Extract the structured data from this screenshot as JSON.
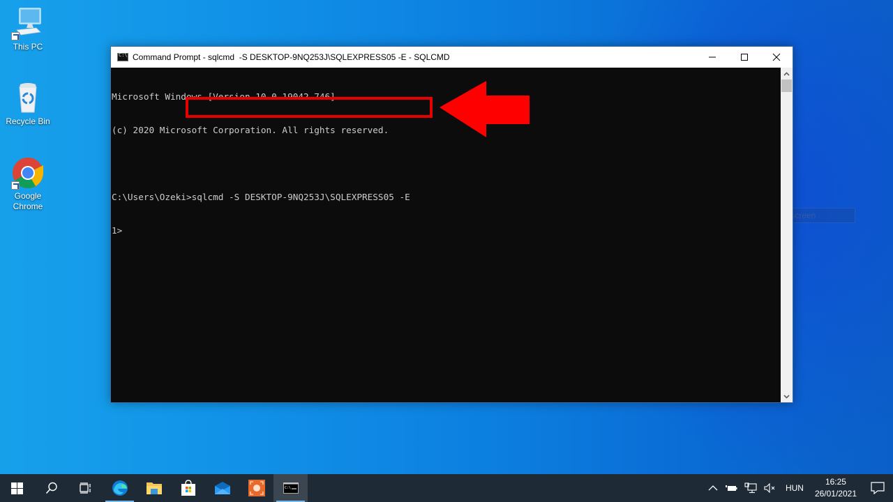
{
  "desktop": {
    "icons": [
      {
        "label": "This PC",
        "icon": "computer-icon",
        "shortcut": true
      },
      {
        "label": "Recycle Bin",
        "icon": "recycle-bin-icon",
        "shortcut": false
      },
      {
        "label": "Google\nChrome",
        "label_line1": "Google",
        "label_line2": "Chrome",
        "icon": "chrome-icon",
        "shortcut": true
      }
    ]
  },
  "window": {
    "title": "Command Prompt - sqlcmd  -S DESKTOP-9NQ253J\\SQLEXPRESS05 -E - SQLCMD",
    "icon": "command-prompt-icon",
    "controls": [
      "minimize",
      "maximize",
      "close"
    ],
    "console_lines": [
      "Microsoft Windows [Version 10.0.19042.746]",
      "(c) 2020 Microsoft Corporation. All rights reserved.",
      "",
      "C:\\Users\\Ozeki>sqlcmd -S DESKTOP-9NQ253J\\SQLEXPRESS05 -E",
      "1>"
    ],
    "highlighted_command": ">sqlcmd -S DESKTOP-9NQ253J\\SQLEXPRESS05 -E"
  },
  "annotation": {
    "color": "#e60000",
    "type": "arrow-pointing-left"
  },
  "ghost_tooltip": "Full screen",
  "taskbar": {
    "items": [
      {
        "name": "start",
        "icon": "windows-logo-icon"
      },
      {
        "name": "search",
        "icon": "search-icon"
      },
      {
        "name": "task-view",
        "icon": "task-view-icon"
      },
      {
        "name": "edge",
        "icon": "edge-icon"
      },
      {
        "name": "file-explorer",
        "icon": "folder-icon"
      },
      {
        "name": "store",
        "icon": "store-icon"
      },
      {
        "name": "mail",
        "icon": "mail-icon"
      },
      {
        "name": "app",
        "icon": "orange-app-icon"
      },
      {
        "name": "command-prompt",
        "icon": "command-prompt-icon",
        "active": true
      }
    ],
    "tray": {
      "language": "HUN",
      "time": "16:25",
      "date": "26/01/2021"
    }
  }
}
